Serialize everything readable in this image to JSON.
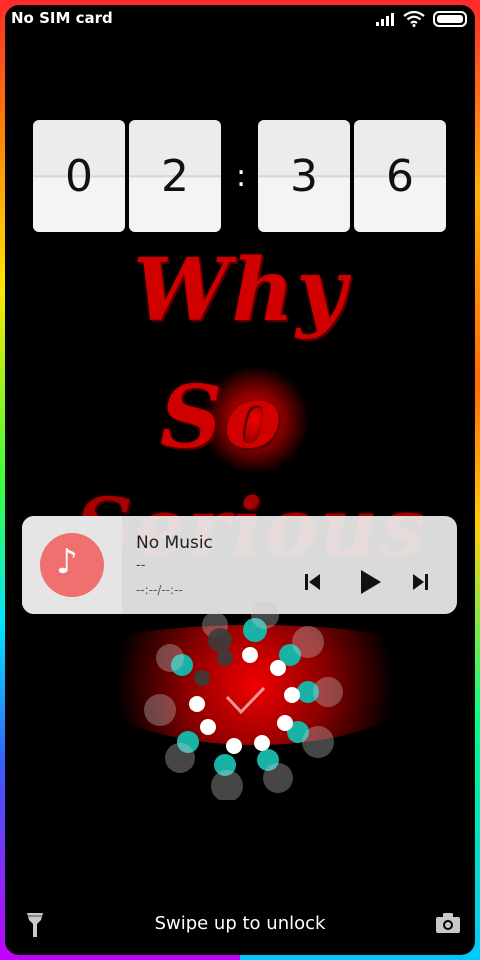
{
  "status_bar": {
    "carrier": "No SIM card",
    "icons": [
      "signal-icon",
      "wifi-icon",
      "battery-icon"
    ]
  },
  "clock": {
    "hour_tens": "0",
    "hour_ones": "2",
    "separator": ":",
    "minute_tens": "3",
    "minute_ones": "6"
  },
  "wallpaper": {
    "line1": "Why",
    "line2": "So",
    "line3": "Serious",
    "accent_color": "#d10000"
  },
  "music": {
    "title": "No Music",
    "artist": "--",
    "time": "--:--/--:--",
    "icon": "music-note-icon",
    "accent_color": "#f07070"
  },
  "bottom": {
    "swipe_text": "Swipe up to unlock",
    "left_icon": "flashlight-icon",
    "right_icon": "camera-icon"
  }
}
